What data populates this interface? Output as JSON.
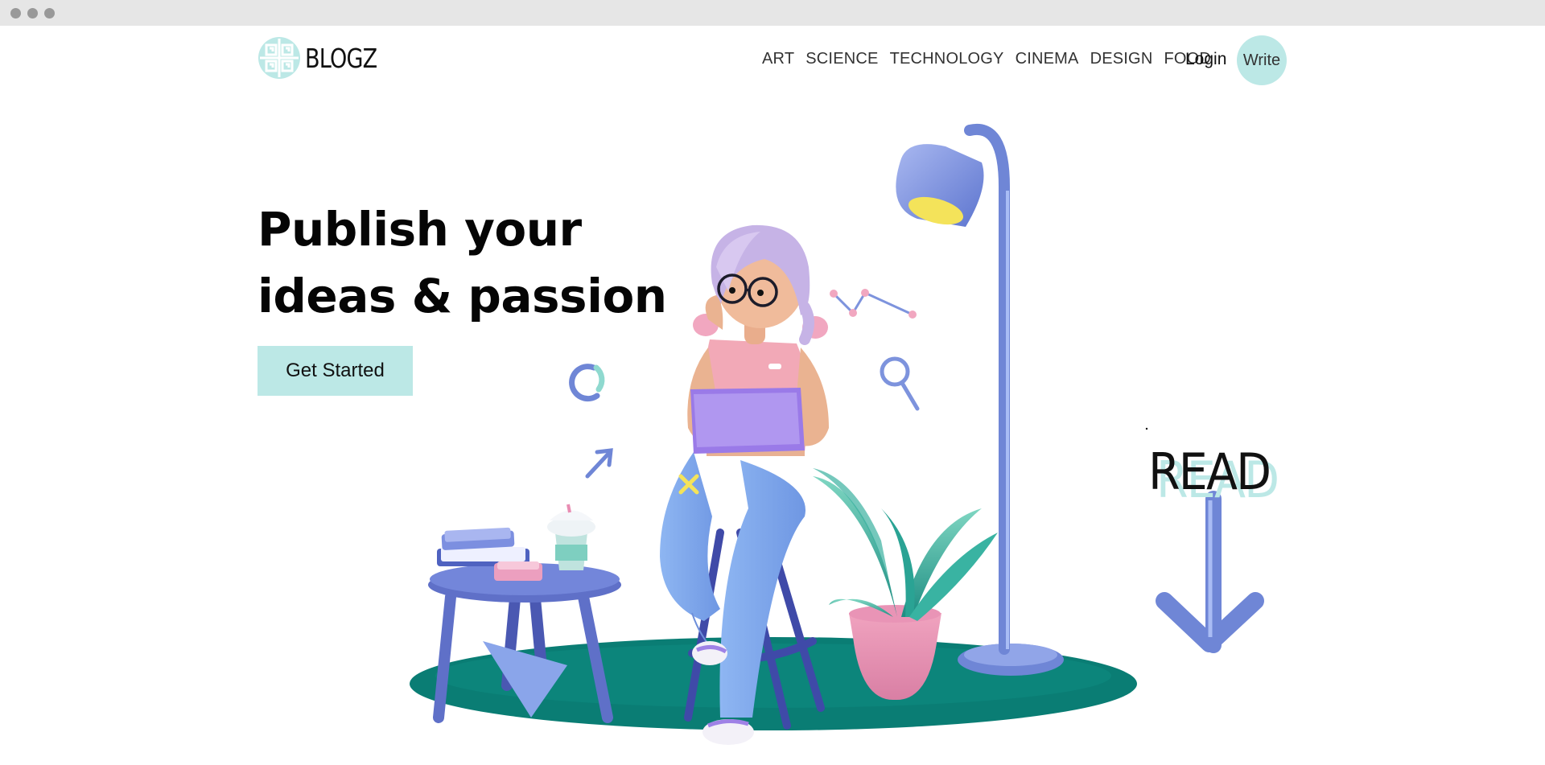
{
  "window": {
    "controls": [
      "close",
      "minimize",
      "maximize"
    ]
  },
  "header": {
    "brand": "BLOGZ",
    "nav": [
      "ART",
      "SCIENCE",
      "TECHNOLOGY",
      "CINEMA",
      "DESIGN",
      "FOOD"
    ],
    "login_label": "Login",
    "write_label": "Write"
  },
  "hero": {
    "title_line1": "Publish your",
    "title_line2": "ideas & passion",
    "cta_label": "Get Started"
  },
  "illustration": {
    "read_text": "READ",
    "icons": [
      "lamp-icon",
      "plant-icon",
      "stool-icon",
      "table-icon",
      "books-icon",
      "coffee-cup-icon",
      "laptop-icon",
      "magnifier-icon",
      "arrow-down-icon"
    ]
  },
  "colors": {
    "accent": "#bce8e6",
    "floor": "#0a7d74",
    "furniture": "#6f86d6",
    "laptop": "#9a7ae8"
  }
}
